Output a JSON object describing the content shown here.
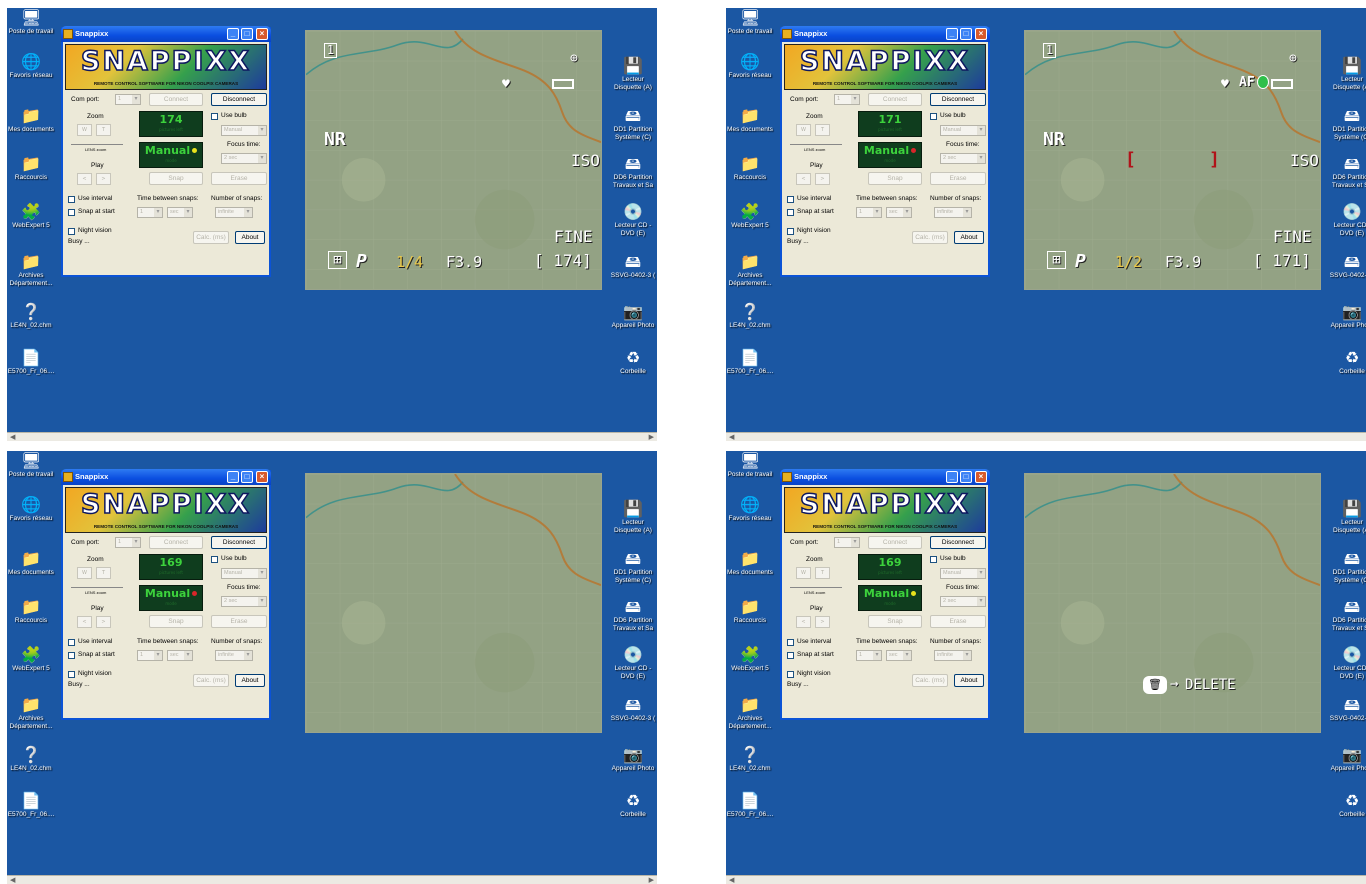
{
  "desktop": {
    "icons_left": [
      "Poste de travail",
      "Favoris réseau",
      "Mes documents",
      "Raccourcis",
      "WebExpert 5",
      "Archives\nDépartement...",
      "LE4N_02.chm",
      "E5700_Fr_06...."
    ],
    "icons_right": [
      "Lecteur\nDisquette (A)",
      "DD1 Partition\nSystème (C)",
      "DD6 Partition\nTravaux et Sa",
      "Lecteur CD -\nDVD (E)",
      "SSVG-0402-3 (",
      "Appareil Photo",
      "Corbeille"
    ]
  },
  "icon_glyphs": {
    "computer": "🖥",
    "network": "🌐",
    "documents": "📁",
    "folder": "📁",
    "webexpert": "🧩",
    "help": "❔",
    "pdf": "📄",
    "floppy": "💾",
    "drive": "🖴",
    "cd": "💿",
    "camera": "📷",
    "recycle": "♻"
  },
  "app": {
    "title": "Snappixx",
    "logo": "SNAPPIXX",
    "tagline": "REMOTE CONTROL SOFTWARE FOR NIKON COOLPIX CAMERAS",
    "com_port_label": "Com port:",
    "com_port_value": "1",
    "connect": "Connect",
    "disconnect": "Disconnect",
    "zoom_label": "Zoom",
    "zoom_w": "W",
    "zoom_t": "T",
    "lens_label": "LENS zoom",
    "play_label": "Play",
    "play_prev": "<",
    "play_next": ">",
    "pictures_left_caption": "pictures left",
    "mode": "Manual",
    "mode_caption": "mode",
    "use_bulb": "Use bulb",
    "bulb_value": "Manual",
    "focus_time_label": "Focus time:",
    "focus_time_value": "2 sec",
    "snap": "Snap",
    "erase": "Erase",
    "use_interval": "Use interval",
    "snap_at_start": "Snap at start",
    "time_between_label": "Time between snaps:",
    "time_value": "1",
    "time_unit": "sec",
    "number_of_snaps_label": "Number of snaps:",
    "number_value": "infinite",
    "night_vision": "Night vision",
    "calc_btn": "Calc. (ms)",
    "about": "About",
    "status": "Busy ..."
  },
  "panels": [
    {
      "pictures_left": "174",
      "mode_dot_color": "#e8e21c",
      "camera": {
        "frame_num": "1",
        "nr": "NR",
        "iso": "ISO",
        "quality": "FINE",
        "mode": "P",
        "shutter": "1/4",
        "aperture": "F3.9",
        "count": "[ 174]",
        "af": ""
      },
      "status_overlay": ""
    },
    {
      "pictures_left": "171",
      "mode_dot_color": "#d8262a",
      "camera": {
        "frame_num": "1",
        "nr": "NR",
        "iso": "ISO",
        "quality": "FINE",
        "mode": "P",
        "shutter": "1/2",
        "aperture": "F3.9",
        "count": "[ 171]",
        "af": "AF"
      },
      "status_overlay": ""
    },
    {
      "pictures_left": "169",
      "mode_dot_color": "#d8262a",
      "camera": null,
      "status_overlay": ""
    },
    {
      "pictures_left": "169",
      "mode_dot_color": "#e8e21c",
      "camera": null,
      "status_overlay": "DELETE"
    }
  ]
}
